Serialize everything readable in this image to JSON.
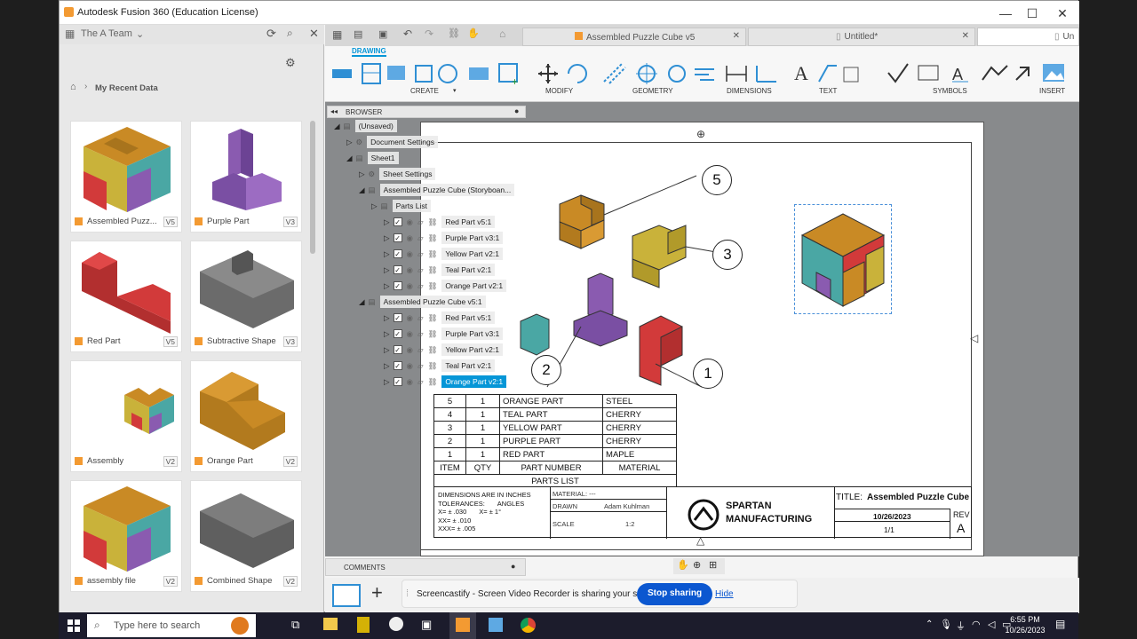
{
  "app": {
    "title": "Autodesk Fusion 360 (Education License)"
  },
  "data_panel": {
    "team": "The A Team",
    "breadcrumb": "My Recent Data",
    "tiles": [
      {
        "label": "Assembled Puzz...",
        "ver": "V5"
      },
      {
        "label": "Purple Part",
        "ver": "V3"
      },
      {
        "label": "Red Part",
        "ver": "V5"
      },
      {
        "label": "Subtractive Shape",
        "ver": "V3"
      },
      {
        "label": "Assembly",
        "ver": "V2"
      },
      {
        "label": "Orange Part",
        "ver": "V2"
      },
      {
        "label": "assembly file",
        "ver": "V2"
      },
      {
        "label": "Combined Shape",
        "ver": "V2"
      }
    ]
  },
  "tabs": [
    {
      "label": "Assembled Puzzle Cube v5"
    },
    {
      "label": "Untitled*"
    },
    {
      "label": "Un"
    }
  ],
  "ribbon": {
    "mode": "DRAWING",
    "groups": [
      "CREATE",
      "MODIFY",
      "GEOMETRY",
      "DIMENSIONS",
      "TEXT",
      "SYMBOLS",
      "INSERT"
    ]
  },
  "browser": {
    "title": "BROWSER",
    "rows": [
      {
        "label": "(Unsaved)"
      },
      {
        "label": "Document Settings"
      },
      {
        "label": "Sheet1"
      },
      {
        "label": "Sheet Settings"
      },
      {
        "label": "Assembled Puzzle Cube (Storyboan..."
      },
      {
        "label": "Parts List"
      },
      {
        "label": "Red Part v5:1"
      },
      {
        "label": "Purple Part v3:1"
      },
      {
        "label": "Yellow Part v2:1"
      },
      {
        "label": "Teal Part v2:1"
      },
      {
        "label": "Orange Part v2:1"
      },
      {
        "label": "Assembled Puzzle Cube v5:1"
      },
      {
        "label": "Red Part v5:1"
      },
      {
        "label": "Purple Part v3:1"
      },
      {
        "label": "Yellow Part v2:1"
      },
      {
        "label": "Teal Part v2:1"
      },
      {
        "label": "Orange Part v2:1"
      }
    ]
  },
  "balloons": [
    "5",
    "3",
    "2",
    "1"
  ],
  "parts_list": {
    "title": "PARTS LIST",
    "headers": [
      "ITEM",
      "QTY",
      "PART NUMBER",
      "MATERIAL"
    ],
    "rows": [
      [
        "5",
        "1",
        "ORANGE PART",
        "STEEL"
      ],
      [
        "4",
        "1",
        "TEAL PART",
        "CHERRY"
      ],
      [
        "3",
        "1",
        "YELLOW PART",
        "CHERRY"
      ],
      [
        "2",
        "1",
        "PURPLE PART",
        "CHERRY"
      ],
      [
        "1",
        "1",
        "RED PART",
        "MAPLE"
      ]
    ]
  },
  "title_block": {
    "dims": "DIMENSIONS ARE IN INCHES",
    "tol": "TOLERANCES:",
    "angles": "ANGLES",
    "x1": "X= ± .030",
    "x2": "XX= ± .010",
    "x3": "XXX= ± .005",
    "ang": "X= ± 1°",
    "material_lbl": "MATERIAL:",
    "material": "---",
    "drawn_lbl": "DRAWN",
    "drawn": "Adam Kuhlman",
    "scale_lbl": "SCALE",
    "scale": "1:2",
    "company1": "SPARTAN",
    "company2": "MANUFACTURING",
    "title_lbl": "TITLE:",
    "title": "Assembled Puzzle Cube",
    "date": "10/26/2023",
    "sheet": "1/1",
    "rev_lbl": "REV",
    "rev": "A"
  },
  "comments": "COMMENTS",
  "notification": {
    "text": "Screencastify - Screen Video Recorder is sharing your screen.",
    "stop": "Stop sharing",
    "hide": "Hide"
  },
  "taskbar": {
    "search": "Type here to search",
    "time": "6:55 PM",
    "date": "10/26/2023"
  },
  "colors": {
    "accent": "#0696d7",
    "orange": "#c98a25",
    "red": "#d23a3a",
    "purple": "#8a5bb0",
    "yellow": "#c9b23a",
    "teal": "#4aa7a4",
    "stop_btn": "#0b57d0"
  }
}
